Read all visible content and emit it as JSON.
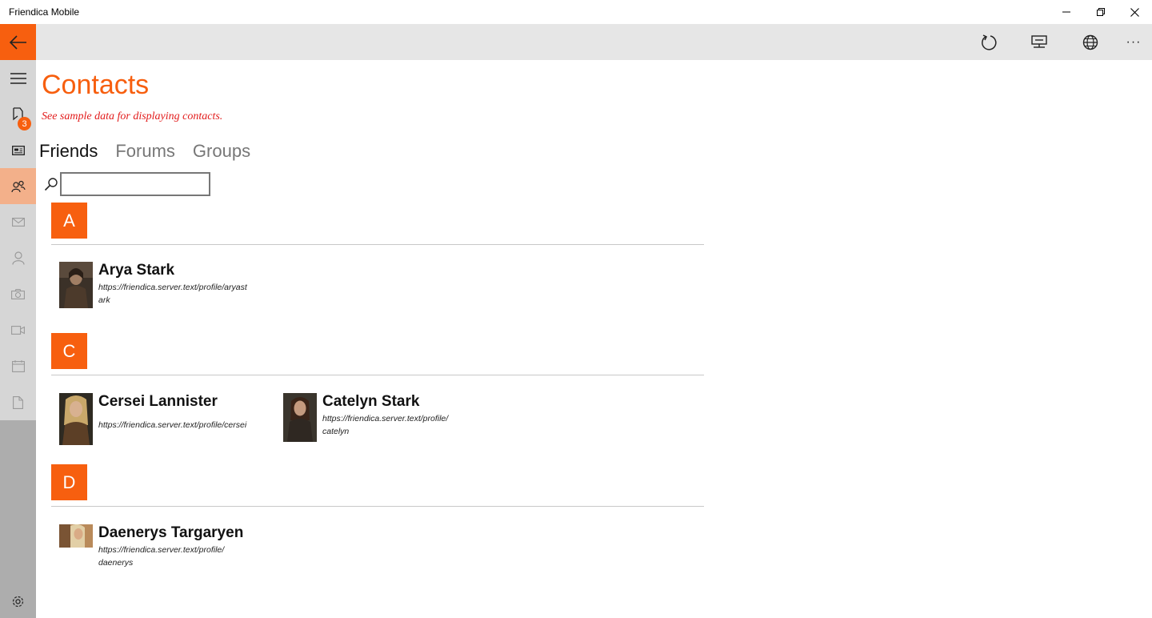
{
  "window": {
    "title": "Friendica Mobile",
    "minimize_label": "—",
    "maximize_label": "❐",
    "close_label": "✕"
  },
  "commandbar": {
    "refresh_icon": "refresh-icon",
    "device_icon": "device-icon",
    "globe_icon": "globe-icon",
    "more_label": "···"
  },
  "sidebar": {
    "notifications_badge": "3",
    "items": [
      "menu",
      "notifications",
      "news",
      "contacts",
      "messages",
      "profile",
      "photos",
      "videos",
      "calendar",
      "documents",
      "settings"
    ]
  },
  "page": {
    "title": "Contacts",
    "subtitle": "See sample data for displaying contacts."
  },
  "tabs": [
    {
      "label": "Friends"
    },
    {
      "label": "Forums"
    },
    {
      "label": "Groups"
    }
  ],
  "search": {
    "value": "",
    "placeholder": ""
  },
  "groups": [
    {
      "letter": "A",
      "contacts": [
        {
          "name": "Arya Stark",
          "url": "https://friendica.server.text/profile/aryastark"
        }
      ]
    },
    {
      "letter": "C",
      "contacts": [
        {
          "name": "Cersei Lannister",
          "url": "https://friendica.server.text/profile/cersei"
        },
        {
          "name": "Catelyn Stark",
          "url": "https://friendica.server.text/profile/catelyn"
        }
      ]
    },
    {
      "letter": "D",
      "contacts": [
        {
          "name": "Daenerys Targaryen",
          "url": "https://friendica.server.text/profile/daenerys"
        }
      ]
    }
  ],
  "colors": {
    "accent": "#f75f0f",
    "subtitle": "#e21b1b",
    "sidebar": "#d6d6d6",
    "sidebar_active": "#f3b08a",
    "commandbar": "#e6e6e6"
  }
}
